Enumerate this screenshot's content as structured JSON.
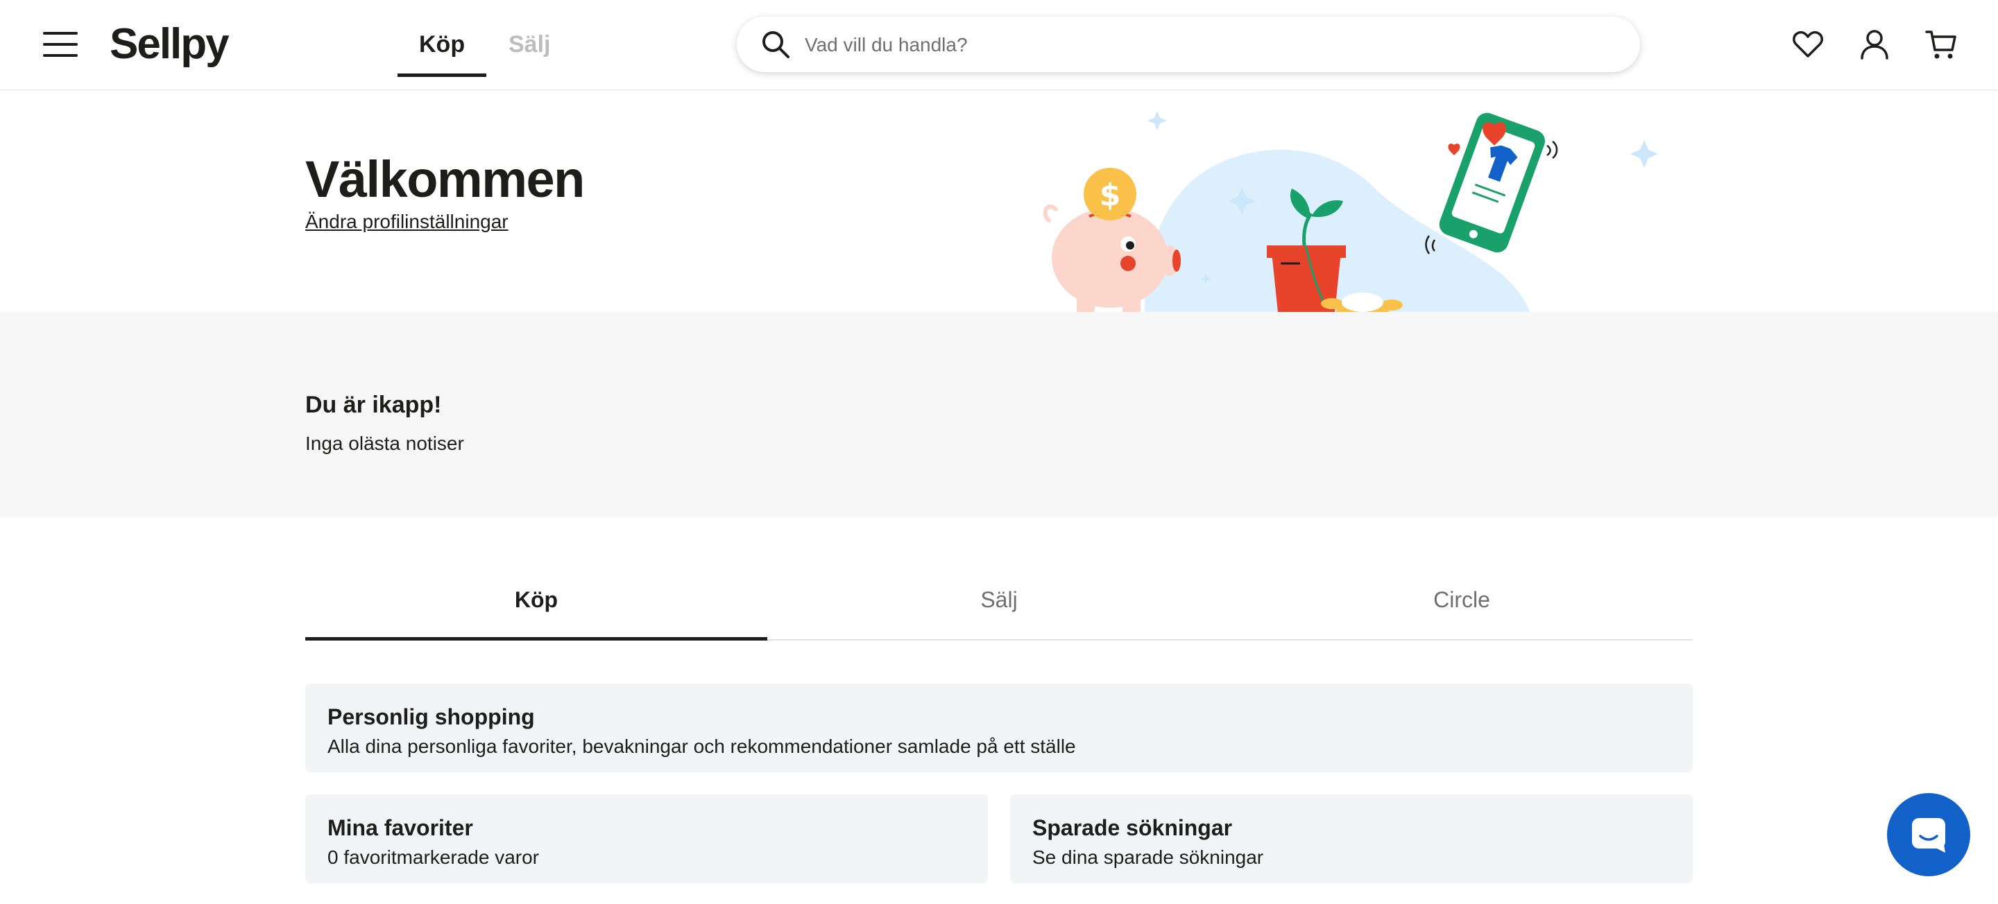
{
  "header": {
    "logo": "Sellpy",
    "tabs": [
      "Köp",
      "Sälj"
    ],
    "search_placeholder": "Vad vill du handla?"
  },
  "hero": {
    "title": "Välkommen",
    "link": "Ändra profilinställningar"
  },
  "notices": {
    "title": "Du är ikapp!",
    "subtitle": "Inga olästa notiser"
  },
  "tabs": [
    "Köp",
    "Sälj",
    "Circle"
  ],
  "cards": {
    "personal": {
      "title": "Personlig shopping",
      "subtitle": "Alla dina personliga favoriter, bevakningar och rekommendationer samlade på ett ställe"
    },
    "favorites": {
      "title": "Mina favoriter",
      "subtitle": "0 favoritmarkerade varor"
    },
    "saved": {
      "title": "Sparade sökningar",
      "subtitle": "Se dina sparade sökningar"
    }
  },
  "icons": {
    "menu": "menu-icon",
    "search": "search-icon",
    "heart": "heart-icon",
    "user": "user-icon",
    "cart": "cart-icon",
    "chat": "chat-icon"
  },
  "colors": {
    "text": "#1d1d1b",
    "band": "#f7f7f7",
    "card": "#f3f4f6",
    "chat": "#1261c9",
    "inactive": "#bdbdbd",
    "illus_blob": "#dceffc",
    "illus_green": "#1aa06a",
    "illus_red": "#e8432b",
    "illus_yellow": "#f9c04a",
    "illus_pink": "#fcd5cb"
  }
}
